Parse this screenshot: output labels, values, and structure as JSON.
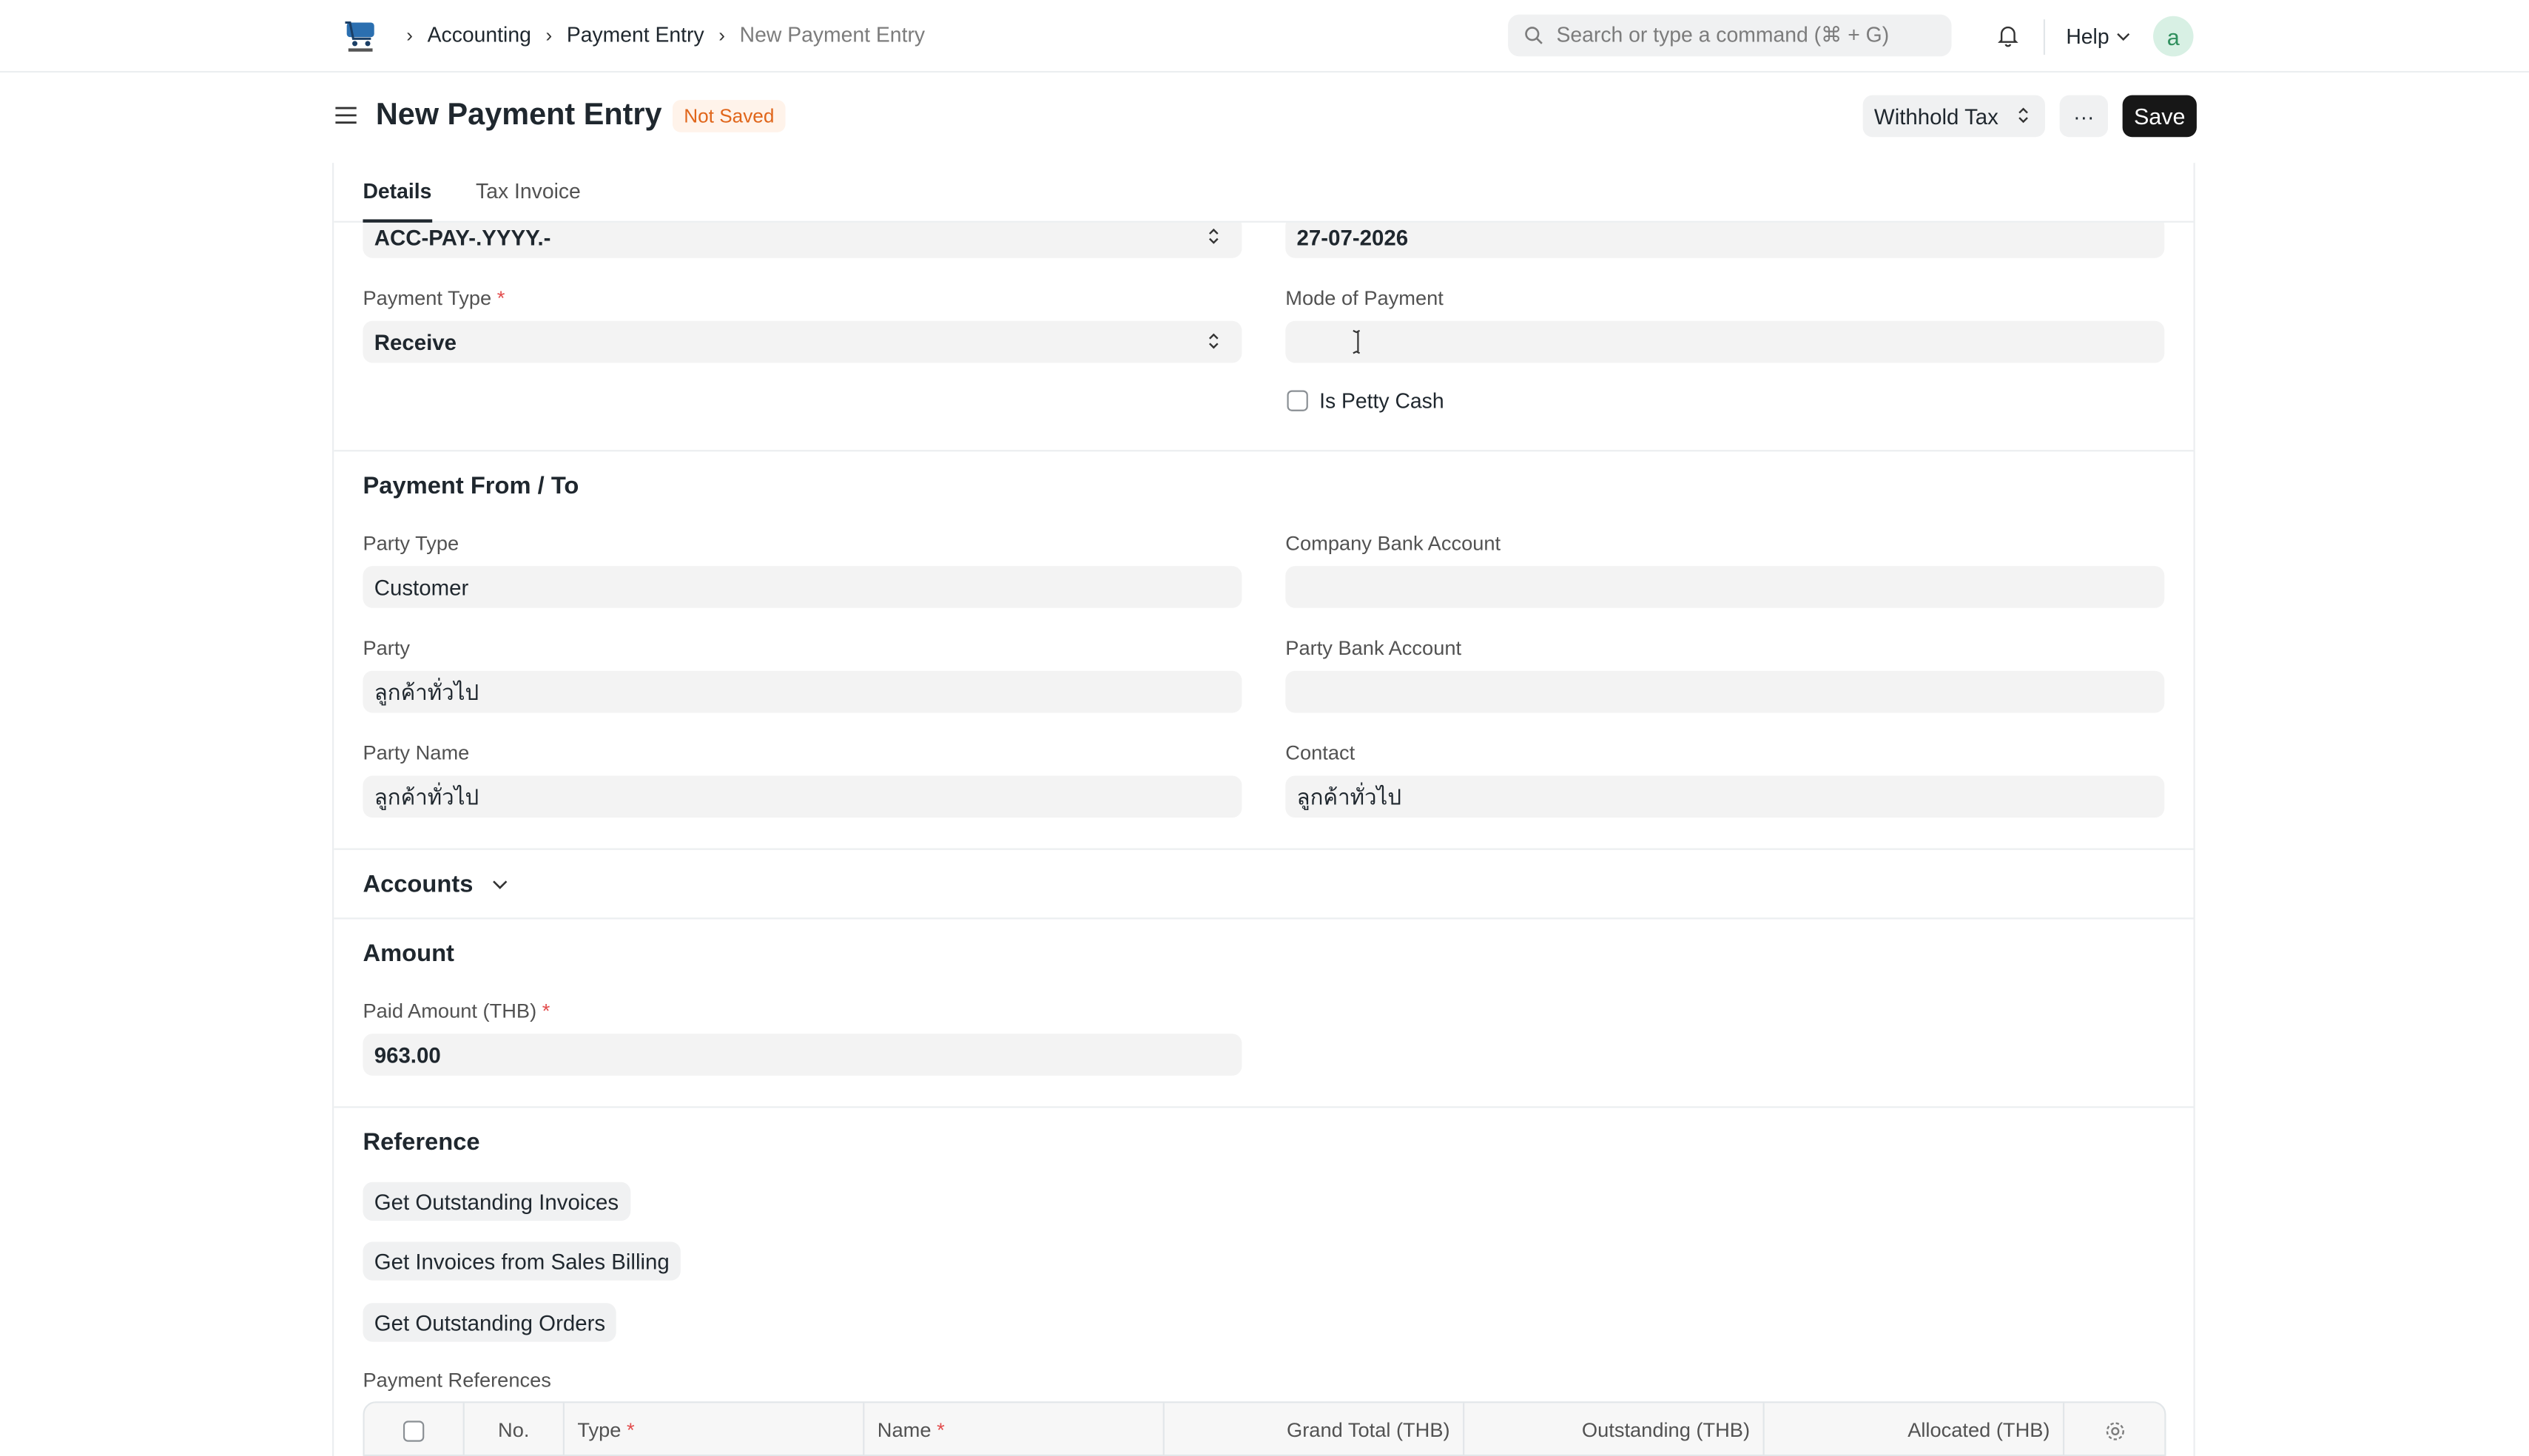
{
  "navbar": {
    "breadcrumbs": [
      "Accounting",
      "Payment Entry",
      "New Payment Entry"
    ],
    "search_placeholder": "Search or type a command (⌘ + G)",
    "help_label": "Help",
    "avatar_letter": "a"
  },
  "page": {
    "title": "New Payment Entry",
    "status": "Not Saved",
    "withhold_label": "Withhold Tax",
    "more_label": "···",
    "save_label": "Save"
  },
  "tabs": [
    "Details",
    "Tax Invoice"
  ],
  "top_fields": {
    "series_value": "ACC-PAY-.YYYY.-",
    "date_value": "27-07-2026",
    "payment_type_label": "Payment Type",
    "payment_type_value": "Receive",
    "mode_of_payment_label": "Mode of Payment",
    "mode_of_payment_value": "",
    "petty_cash_label": "Is Petty Cash",
    "petty_cash_checked": false
  },
  "payment_from_to": {
    "heading": "Payment From / To",
    "party_type_label": "Party Type",
    "party_type_value": "Customer",
    "company_bank_label": "Company Bank Account",
    "company_bank_value": "",
    "party_label": "Party",
    "party_value": "ลูกค้าทั่วไป",
    "party_bank_label": "Party Bank Account",
    "party_bank_value": "",
    "party_name_label": "Party Name",
    "party_name_value": "ลูกค้าทั่วไป",
    "contact_label": "Contact",
    "contact_value": "ลูกค้าทั่วไป"
  },
  "accounts": {
    "heading": "Accounts"
  },
  "amount": {
    "heading": "Amount",
    "paid_amount_label": "Paid Amount (THB)",
    "paid_amount_value": "963.00"
  },
  "reference": {
    "heading": "Reference",
    "buttons": [
      "Get Outstanding Invoices",
      "Get Invoices from Sales Billing",
      "Get Outstanding Orders"
    ],
    "table_label": "Payment References",
    "columns": {
      "no": "No.",
      "type": "Type",
      "name": "Name",
      "grand_total": "Grand Total (THB)",
      "outstanding": "Outstanding (THB)",
      "allocated": "Allocated (THB)"
    }
  },
  "colors": {
    "accent_dark": "#171717",
    "status_orange": "#e0661b",
    "status_bg": "#fff3ea",
    "required_red": "#e24c4c",
    "avatar_bg": "#d8f0e4",
    "avatar_fg": "#2f8f5d"
  }
}
